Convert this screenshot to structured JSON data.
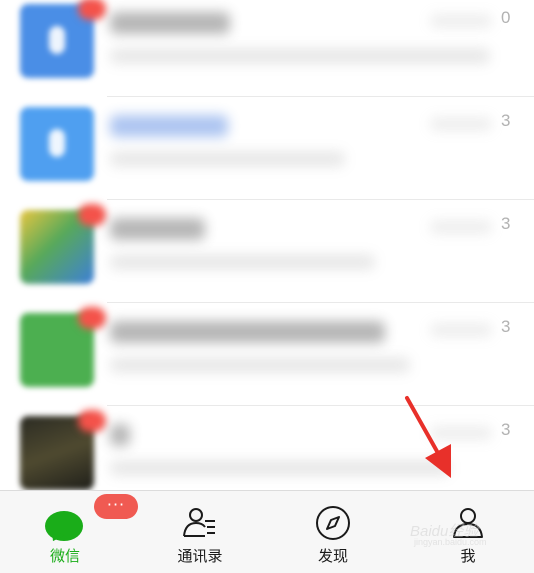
{
  "chat_list": {
    "rows": [
      {
        "time_fragment": "0"
      },
      {
        "time_fragment": "3"
      },
      {
        "time_fragment": "3"
      },
      {
        "time_fragment": "3"
      },
      {
        "time_fragment": "3"
      }
    ]
  },
  "tab_bar": {
    "tabs": [
      {
        "label": "微信",
        "icon": "chat-bubble-icon",
        "active": true,
        "badge": "···"
      },
      {
        "label": "通讯录",
        "icon": "contacts-icon",
        "active": false
      },
      {
        "label": "发现",
        "icon": "compass-icon",
        "active": false
      },
      {
        "label": "我",
        "icon": "person-icon",
        "active": false
      }
    ]
  },
  "colors": {
    "accent": "#1aad19",
    "badge": "#f05a52",
    "annotation_arrow": "#e8302a"
  },
  "watermark": {
    "text": "Baidu经验",
    "sub": "jingyan.baidu.com"
  }
}
